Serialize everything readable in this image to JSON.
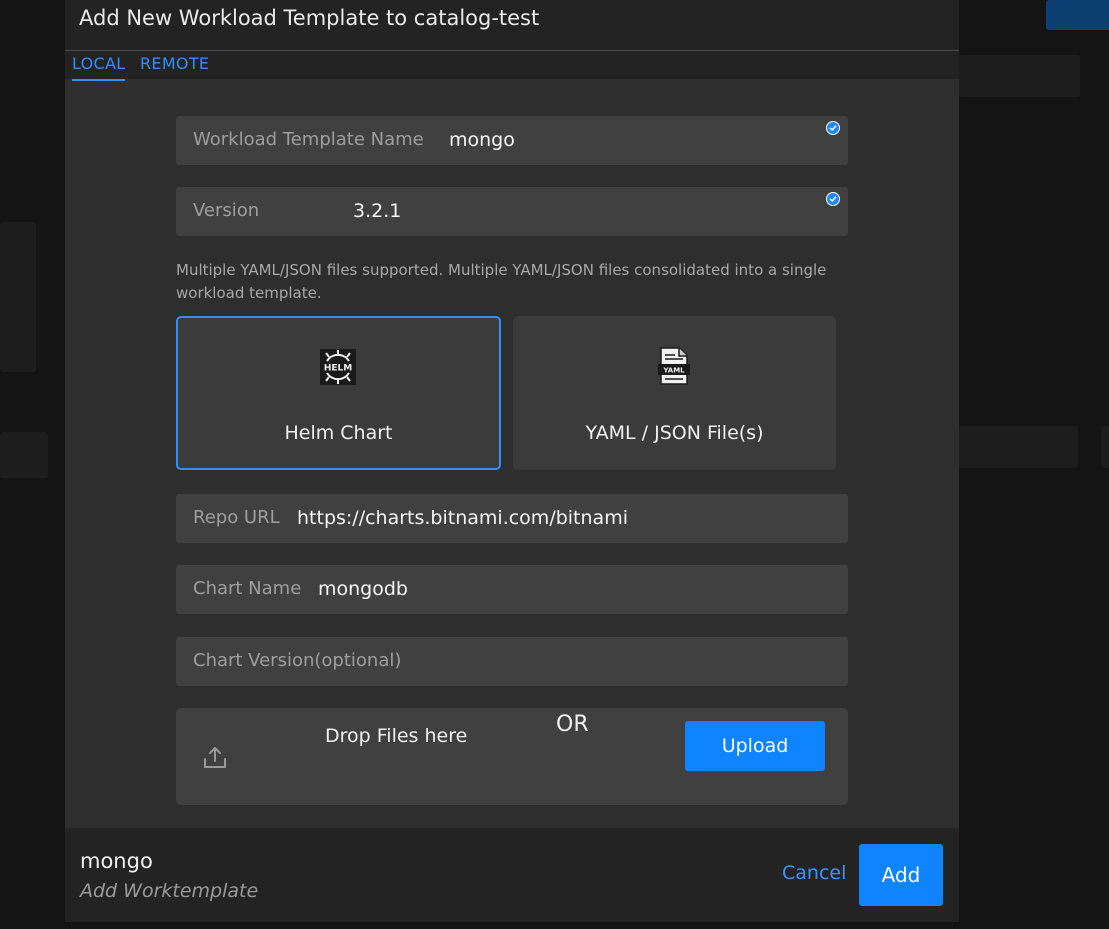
{
  "dialog": {
    "title": "Add New Workload Template to catalog-test",
    "tabs": [
      {
        "label": "LOCAL",
        "active": true
      },
      {
        "label": "REMOTE",
        "active": false
      }
    ]
  },
  "fields": {
    "template_name": {
      "label": "Workload Template Name",
      "value": "mongo",
      "validated": true
    },
    "version": {
      "label": "Version",
      "value": "3.2.1",
      "validated": true
    }
  },
  "hint": "Multiple YAML/JSON files supported. Multiple YAML/JSON files consolidated into a single workload template.",
  "types": [
    {
      "label": "Helm Chart",
      "icon": "helm-icon",
      "selected": true
    },
    {
      "label": "YAML / JSON File(s)",
      "icon": "yaml-file-icon",
      "selected": false
    }
  ],
  "helm": {
    "repo_url": {
      "label": "Repo URL",
      "value": "https://charts.bitnami.com/bitnami"
    },
    "chart_name": {
      "label": "Chart Name",
      "value": "mongodb"
    },
    "chart_version": {
      "placeholder": "Chart Version(optional)",
      "value": ""
    }
  },
  "upload": {
    "drop_text": "Drop Files here",
    "or_text": "OR",
    "button_label": "Upload"
  },
  "footer": {
    "name": "mongo",
    "subtitle": "Add Worktemplate",
    "cancel_label": "Cancel",
    "add_label": "Add"
  },
  "colors": {
    "accent": "#0f84ff",
    "tab_active": "#2f8fff",
    "dialog_bg": "#2e2e2e",
    "field_bg": "#404040"
  }
}
